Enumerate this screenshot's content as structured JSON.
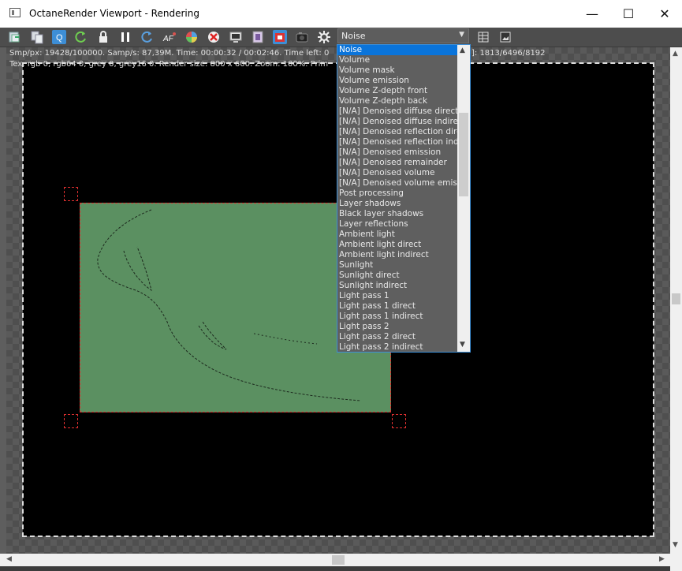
{
  "window": {
    "title": "OctaneRender Viewport - Rendering",
    "minimize_glyph": "—",
    "maximize_glyph": "☐",
    "close_glyph": "✕"
  },
  "toolbar": {
    "icons": [
      "save-render-icon",
      "copy-icon",
      "quick-q-icon",
      "restart-render-icon",
      "lock-icon",
      "pause-icon",
      "reset-icon",
      "auto-focus-icon",
      "color-picker-icon",
      "clear-icon",
      "settings-window-icon",
      "film-strip-icon",
      "region-render-icon",
      "camera-icon",
      "gear-icon"
    ],
    "af_label": "AF",
    "q_label": "Q",
    "render_pass": {
      "selected": "Noise",
      "options": [
        "Noise",
        "Volume",
        "Volume mask",
        "Volume emission",
        "Volume Z-depth front",
        "Volume Z-depth back",
        "[N/A] Denoised diffuse direct",
        "[N/A] Denoised diffuse indirect",
        "[N/A] Denoised reflection direct",
        "[N/A] Denoised reflection indirect",
        "[N/A] Denoised emission",
        "[N/A] Denoised remainder",
        "[N/A] Denoised volume",
        "[N/A] Denoised volume emission",
        "Post processing",
        "Layer shadows",
        "Black layer shadows",
        "Layer reflections",
        "Ambient light",
        "Ambient light direct",
        "Ambient light indirect",
        "Sunlight",
        "Sunlight direct",
        "Sunlight indirect",
        "Light pass 1",
        "Light pass 1 direct",
        "Light pass 1 indirect",
        "Light pass 2",
        "Light pass 2 direct",
        "Light pass 2 indirect"
      ]
    },
    "right_icons": [
      "grid-view-icon",
      "image-view-icon"
    ]
  },
  "status": {
    "line1_left": "Smp/px: 19428/100000.   Samp/s: 87,39M.   Time: 00:00:32 / 00:02:46.   Time left: 0",
    "line1_right": "]: 1813/6496/8192",
    "line2": "Tex: rgb 0, rgb64 0, grey 0, grey16 0.   Render size: 800 x 600.   Zoom: 100%.   Prim"
  },
  "colors": {
    "accent": "#3d8ed6",
    "selected_item": "#0a74da",
    "region_fill": "#5b9061",
    "region_border": "#e03030"
  }
}
